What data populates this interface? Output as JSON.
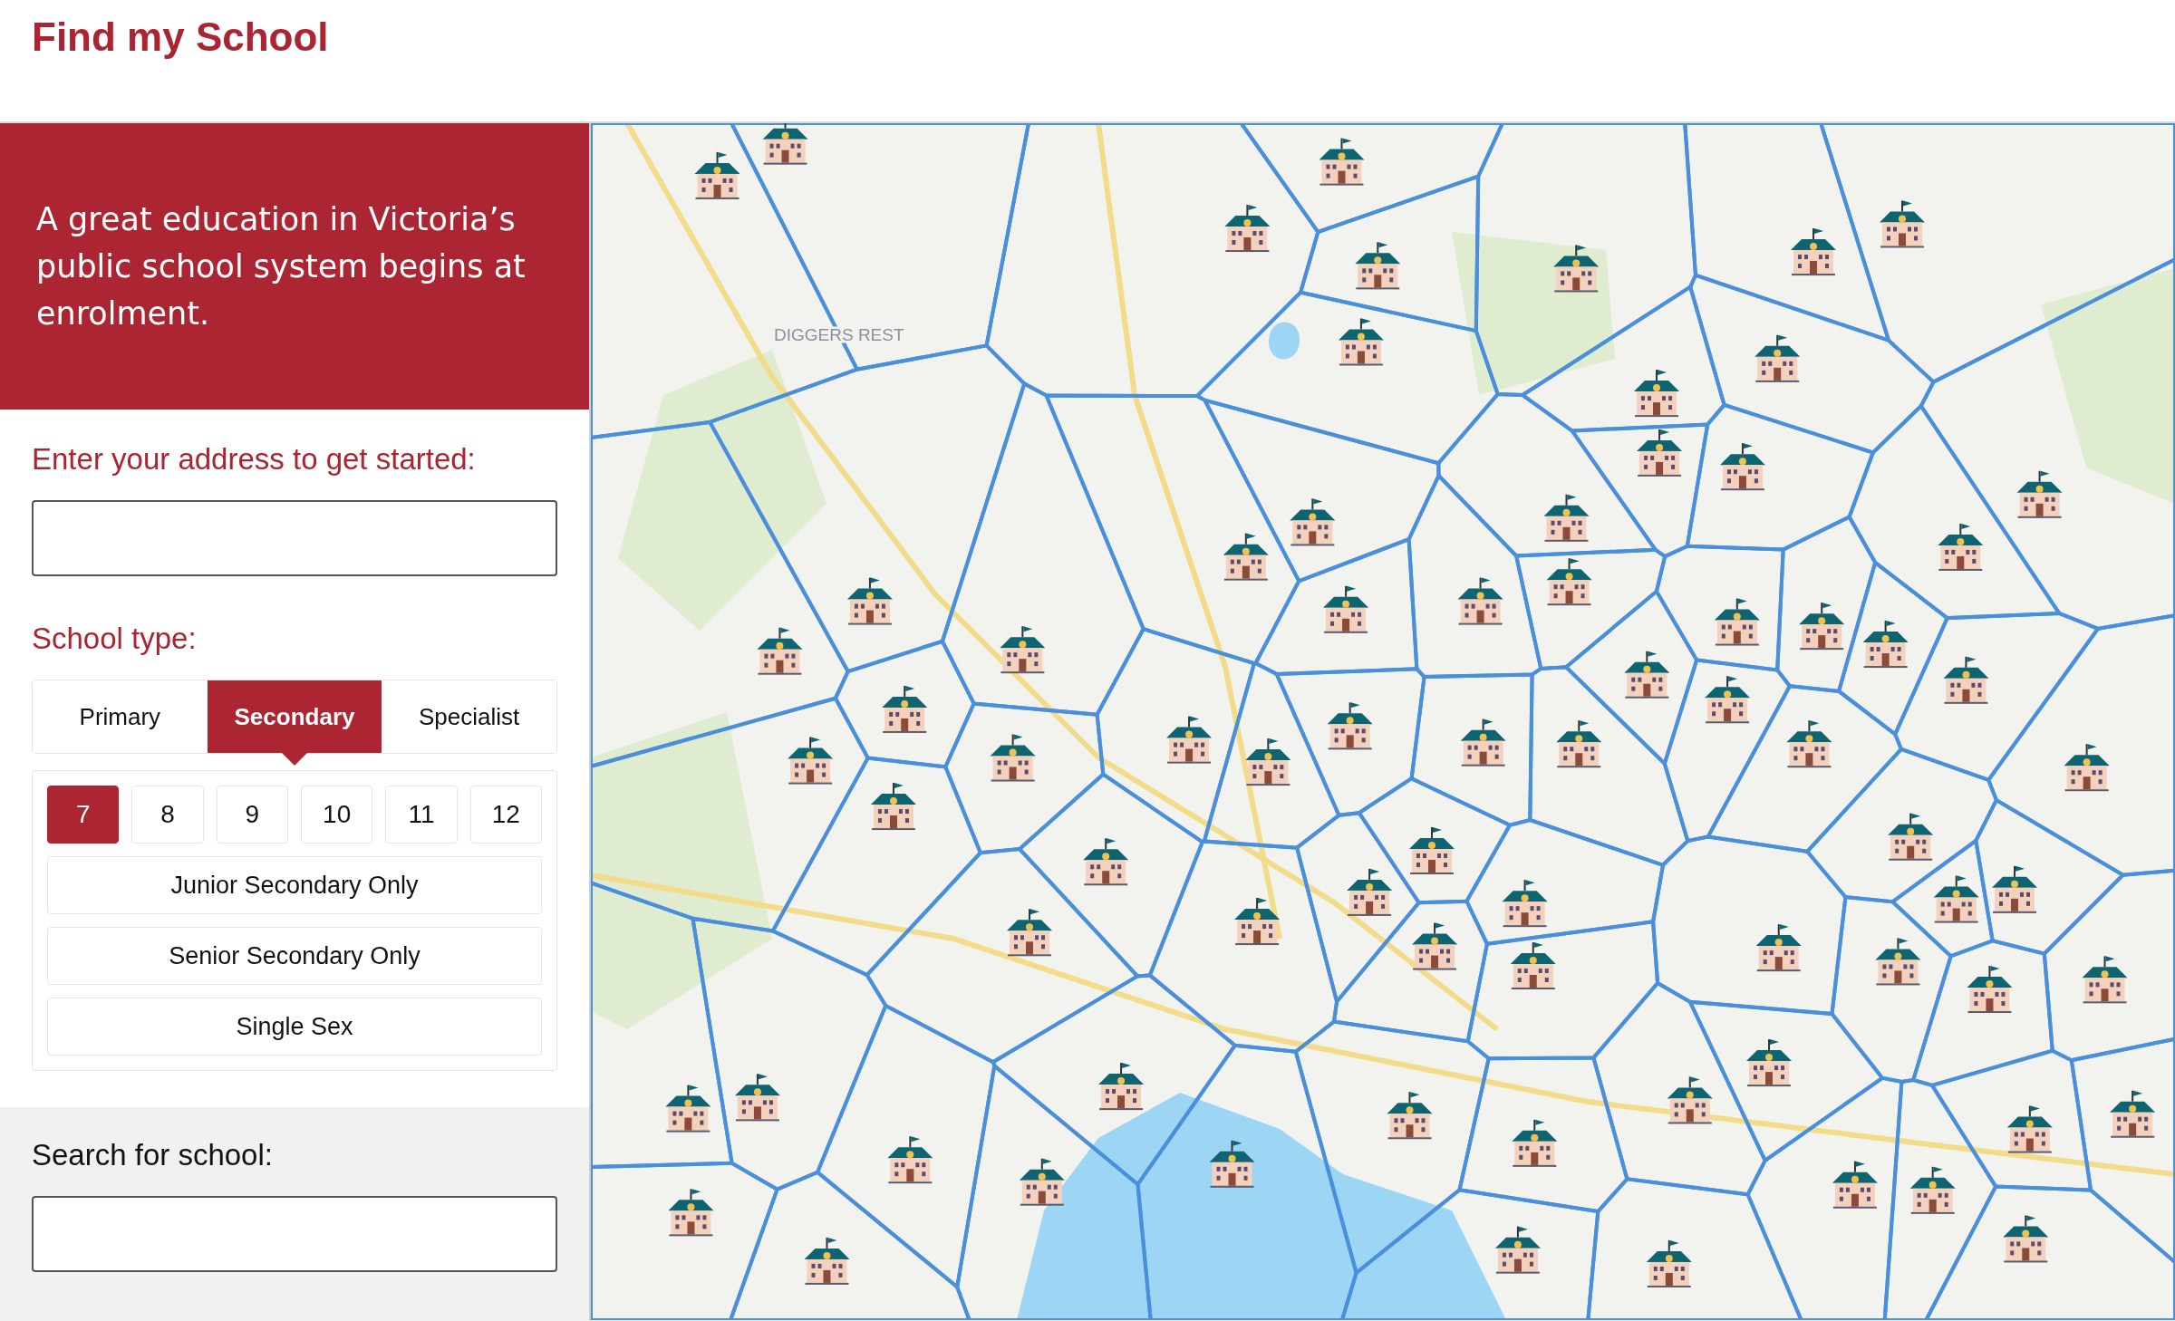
{
  "header": {
    "title": "Find my School"
  },
  "banner": {
    "text": "A great education in Victoria’s public school system begins at enrolment."
  },
  "address": {
    "label": "Enter your address to get started:"
  },
  "school_type": {
    "label": "School type:",
    "tabs": [
      {
        "label": "Primary",
        "selected": false
      },
      {
        "label": "Secondary",
        "selected": true
      },
      {
        "label": "Specialist",
        "selected": false
      }
    ],
    "years": [
      {
        "label": "7",
        "selected": true
      },
      {
        "label": "8",
        "selected": false
      },
      {
        "label": "9",
        "selected": false
      },
      {
        "label": "10",
        "selected": false
      },
      {
        "label": "11",
        "selected": false
      },
      {
        "label": "12",
        "selected": false
      }
    ],
    "options": [
      {
        "label": "Junior Secondary Only",
        "selected": false
      },
      {
        "label": "Senior Secondary Only",
        "selected": false
      },
      {
        "label": "Single Sex",
        "selected": false
      }
    ]
  },
  "search": {
    "label": "Search for school:"
  },
  "map": {
    "labels": [
      "DIGGERS REST"
    ]
  }
}
